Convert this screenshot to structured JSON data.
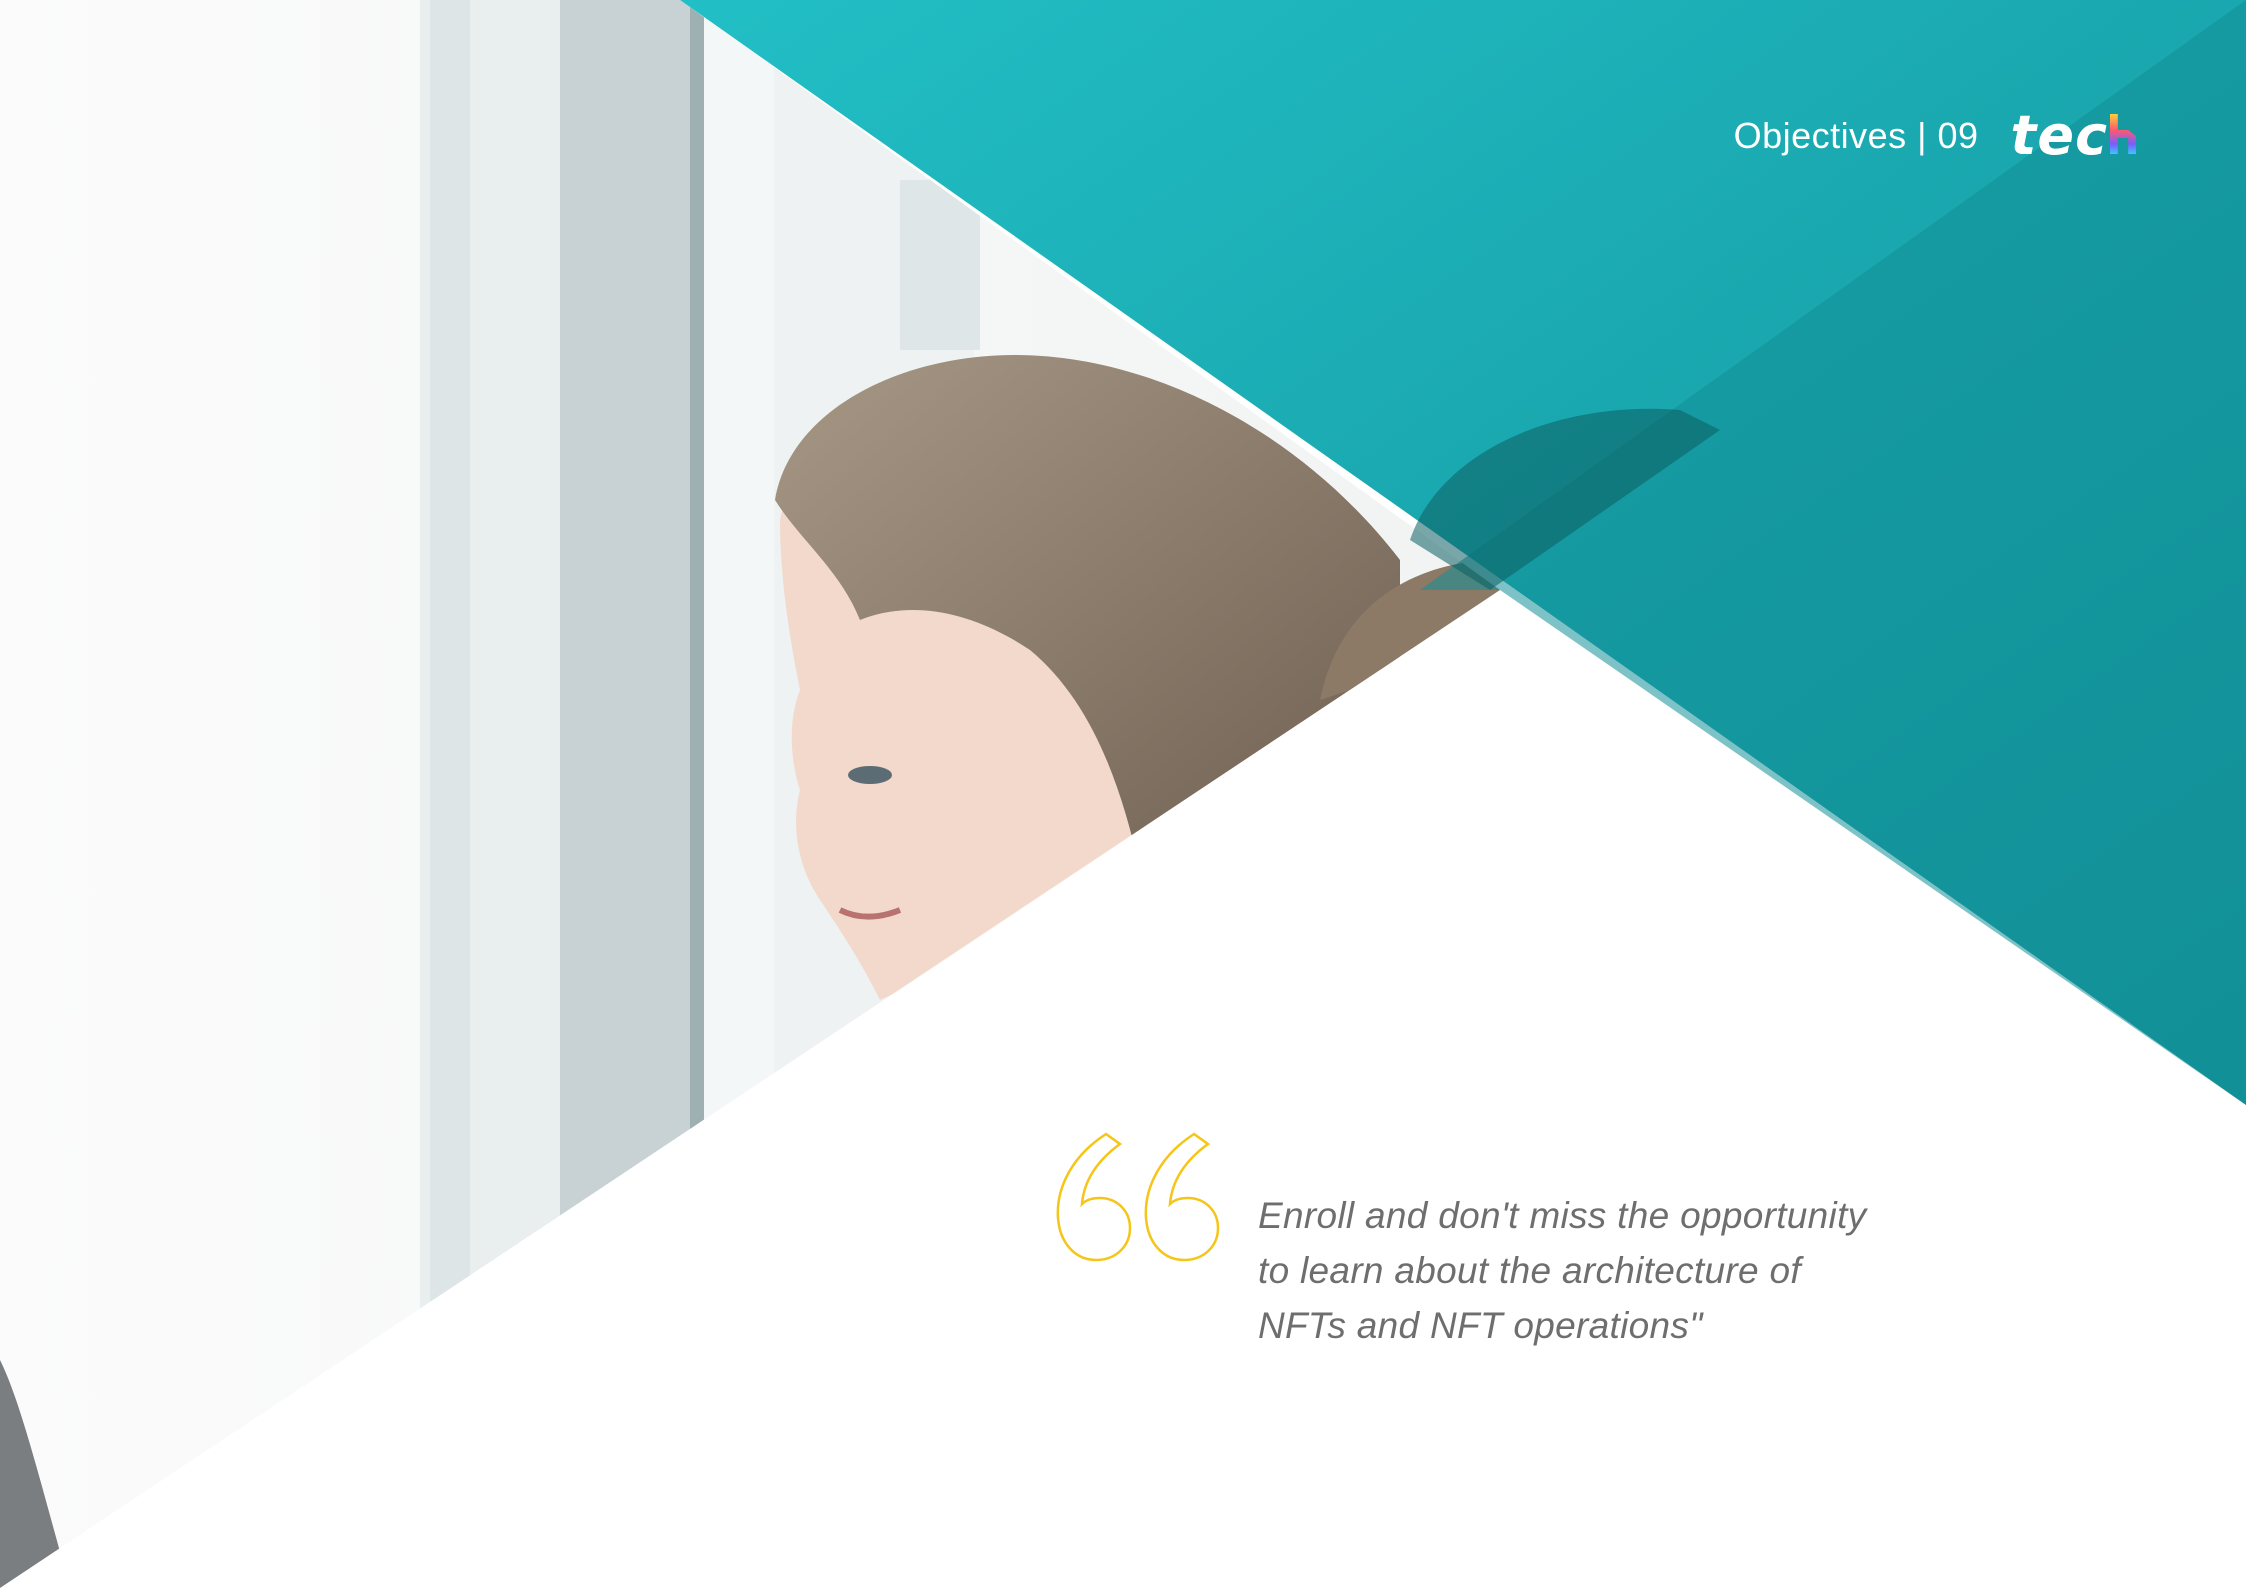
{
  "header": {
    "section_label": "Objectives | 09",
    "logo_text": "tec"
  },
  "quote": {
    "lines": [
      "Enroll and don't miss the opportunity",
      "to learn about the architecture of",
      "NFTs and NFT operations\""
    ]
  },
  "colors": {
    "teal": "#1aa8b0",
    "teal_dark": "#138f97",
    "quote_mark": "#f5c518",
    "quote_text": "#6e6e6e"
  }
}
